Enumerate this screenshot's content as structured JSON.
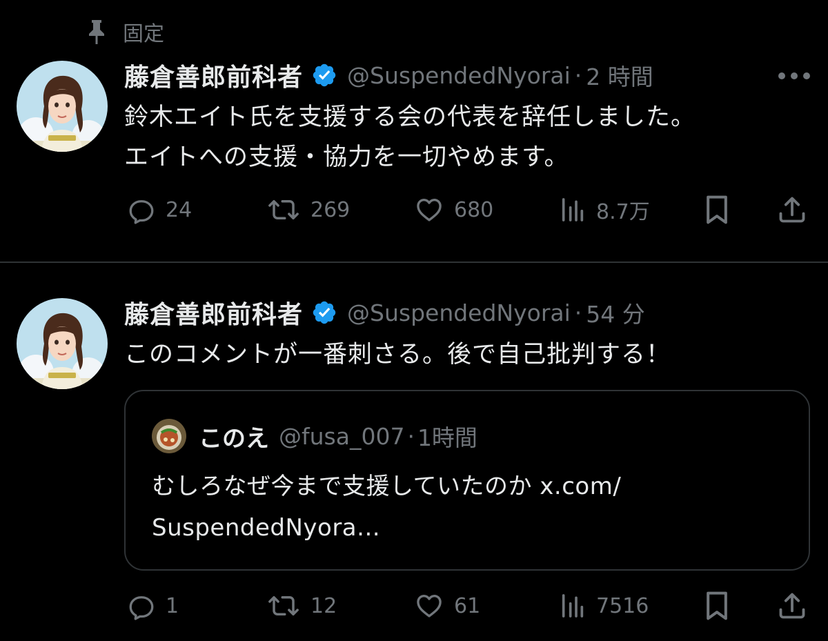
{
  "pinned": {
    "label": "固定",
    "icon": "pin-icon"
  },
  "tweets": [
    {
      "display_name": "藤倉善郎前科者",
      "handle": "@SuspendedNyorai",
      "separator": "·",
      "time": "2 時間",
      "text_lines": [
        "鈴木エイト氏を支援する会の代表を辞任しました。",
        "エイトへの支援・協力を一切やめます。"
      ],
      "stats": {
        "replies": "24",
        "reposts": "269",
        "likes": "680",
        "views": "8.7万"
      }
    },
    {
      "display_name": "藤倉善郎前科者",
      "handle": "@SuspendedNyorai",
      "separator": "·",
      "time": "54 分",
      "text_lines": [
        "このコメントが一番刺さる。後で自己批判する！"
      ],
      "quote": {
        "display_name": "このえ",
        "handle": "@fusa_007",
        "separator": "·",
        "time": "1時間",
        "text_lines": [
          "むしろなぜ今まで支援していたのか x.com/",
          "SuspendedNyora..."
        ]
      },
      "stats": {
        "replies": "1",
        "reposts": "12",
        "likes": "61",
        "views": "7516"
      }
    }
  ],
  "colors": {
    "background": "#000000",
    "text": "#e7e9ea",
    "secondary": "#71767b",
    "border": "#2f3336",
    "verified": "#1d9bf0"
  }
}
